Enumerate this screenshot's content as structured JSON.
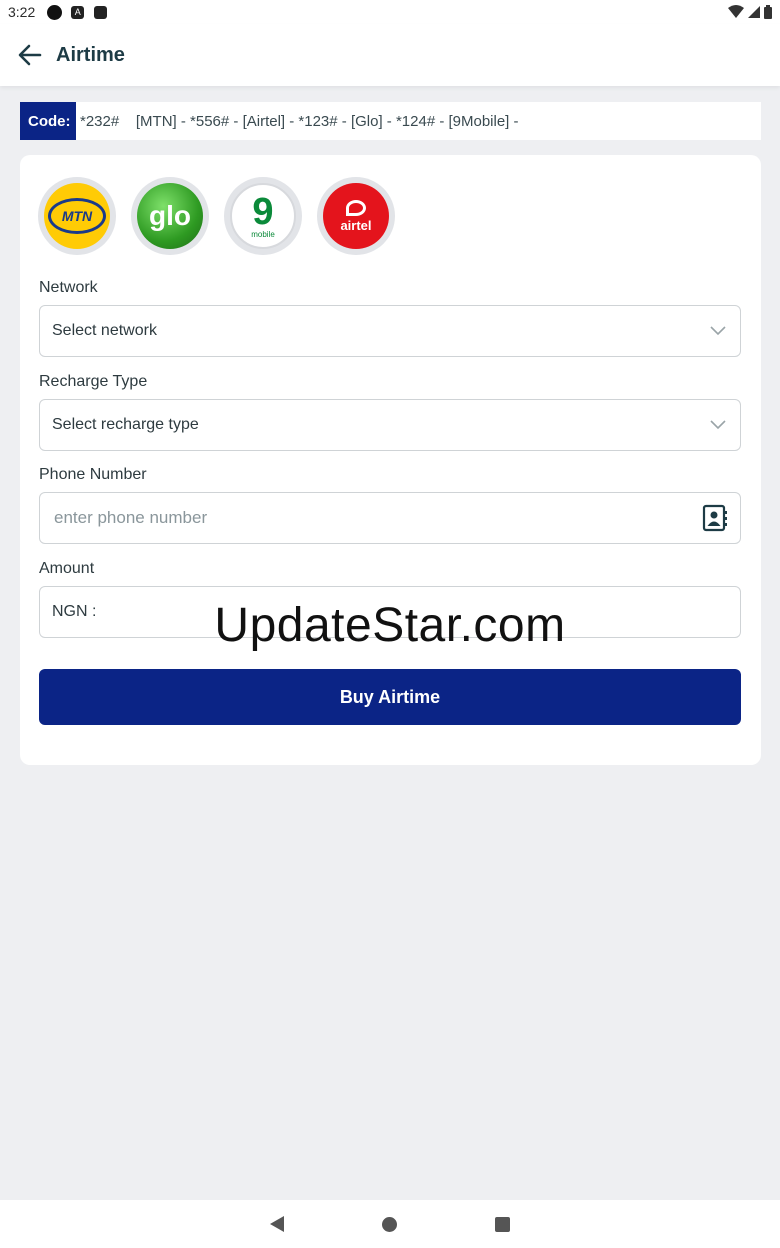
{
  "status_bar": {
    "time": "3:22",
    "notif_icon_a": "A"
  },
  "app_bar": {
    "title": "Airtime"
  },
  "codes": {
    "label": "Code:",
    "text": "*232#    [MTN] - *556# - [Airtel] - *123# - [Glo] - *124# - [9Mobile] -"
  },
  "logos": {
    "mtn": "MTN",
    "glo": "glo",
    "nine": "9",
    "nine_sub": "mobile",
    "airtel": "airtel"
  },
  "form": {
    "network_label": "Network",
    "network_placeholder": "Select network",
    "recharge_label": "Recharge Type",
    "recharge_placeholder": "Select recharge type",
    "phone_label": "Phone Number",
    "phone_placeholder": "enter phone number",
    "amount_label": "Amount",
    "amount_prefix": "NGN :"
  },
  "buy_button": "Buy Airtime",
  "watermark": "UpdateStar.com",
  "colors": {
    "brand": "#0b2486",
    "background": "#eeeff2",
    "mtn_yellow": "#ffcb05",
    "glo_green": "#2e9a22",
    "nine_green": "#0b8a3a",
    "airtel_red": "#e4141c"
  }
}
